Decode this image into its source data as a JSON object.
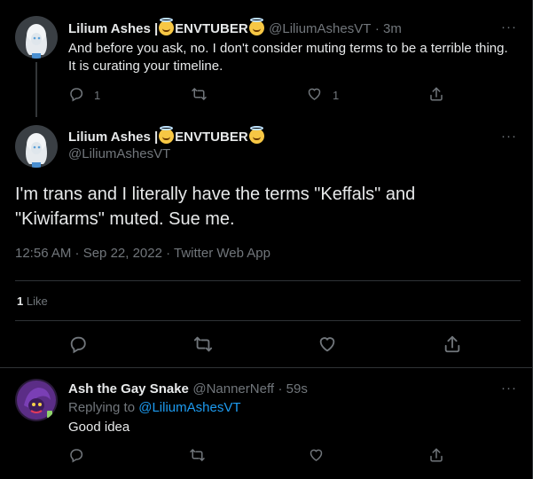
{
  "parent_tweet": {
    "name": "Lilium Ashes |",
    "name_suffix": "ENVTUBER",
    "handle": "@LiliumAshesVT",
    "time": "· 3m",
    "text_line1": "And before you ask, no. I don't consider muting terms to be a terrible thing.",
    "text_line2": "It is curating your timeline.",
    "reply_count": "1",
    "like_count": "1"
  },
  "main_tweet": {
    "name": "Lilium Ashes |",
    "name_suffix": "ENVTUBER",
    "handle": "@LiliumAshesVT",
    "text_line1": "I'm trans and I literally have the terms \"Keffals\" and",
    "text_line2": "\"Kiwifarms\" muted. Sue me.",
    "meta": "12:56 AM · Sep 22, 2022 · Twitter Web App",
    "likes_number": "1",
    "likes_label": "Like"
  },
  "reply_tweet": {
    "name": "Ash the Gay Snake",
    "handle": "@NannerNeff",
    "time": "· 59s",
    "replying_to_label": "Replying to",
    "replying_to_handle": "@LiliumAshesVT",
    "text": "Good idea"
  },
  "icons": {
    "reply": "reply-icon",
    "retweet": "retweet-icon",
    "like": "heart-icon",
    "share": "share-icon",
    "more": "more-icon"
  },
  "colors": {
    "background": "#000000",
    "text_primary": "#e7e9ea",
    "text_secondary": "#71767b",
    "link": "#1d9bf0",
    "divider": "#2f3336"
  }
}
